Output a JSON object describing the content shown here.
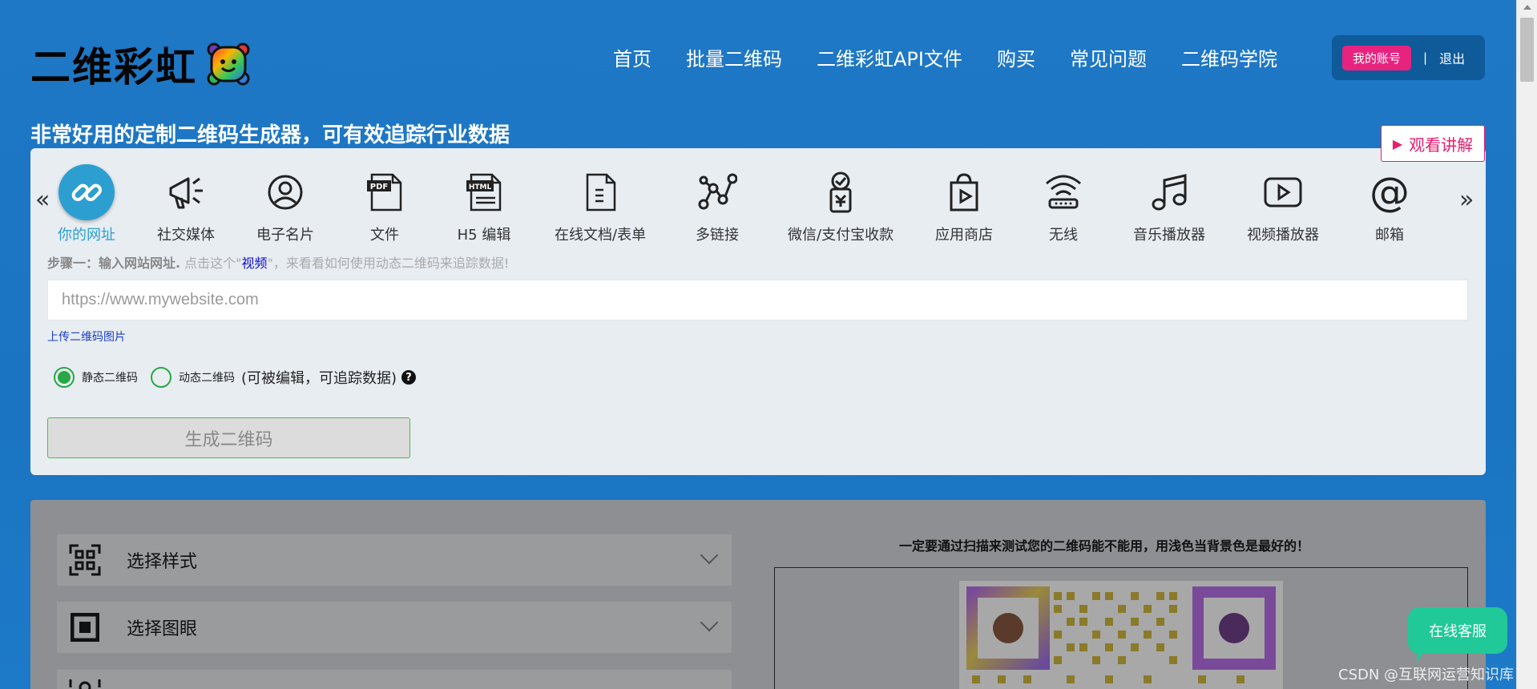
{
  "header": {
    "logo_text": "二维彩虹",
    "nav": [
      "首页",
      "批量二维码",
      "二维彩虹API文件",
      "购买",
      "常见问题",
      "二维码学院"
    ],
    "account_label": "我的账号",
    "separator": "|",
    "logout_label": "退出"
  },
  "tagline": "非常好用的定制二维码生成器，可有效追踪行业数据",
  "watch_button": "观看讲解",
  "carousel": {
    "prev": "«",
    "next": "»",
    "types": [
      {
        "label": "你的网址",
        "icon": "link-icon"
      },
      {
        "label": "社交媒体",
        "icon": "megaphone-icon"
      },
      {
        "label": "电子名片",
        "icon": "user-icon"
      },
      {
        "label": "文件",
        "icon": "pdf-icon"
      },
      {
        "label": "H5 编辑",
        "icon": "html-icon"
      },
      {
        "label": "在线文档/表单",
        "icon": "document-icon"
      },
      {
        "label": "多链接",
        "icon": "network-icon"
      },
      {
        "label": "微信/支付宝收款",
        "icon": "payment-icon"
      },
      {
        "label": "应用商店",
        "icon": "app-store-icon"
      },
      {
        "label": "无线",
        "icon": "wifi-icon"
      },
      {
        "label": "音乐播放器",
        "icon": "music-icon"
      },
      {
        "label": "视频播放器",
        "icon": "video-icon"
      },
      {
        "label": "邮箱",
        "icon": "email-icon"
      }
    ]
  },
  "step": {
    "prefix": "步骤一：输入网站网址.",
    "text1": " 点击这个\"",
    "link": "视频",
    "text2": "\"，来看看如何使用动态二维码来追踪数据!"
  },
  "url_input": {
    "placeholder": "https://www.mywebsite.com",
    "value": ""
  },
  "upload_link": "上传二维码图片",
  "radios": {
    "static_label": "静态二维码",
    "dynamic_label": "动态二维码",
    "dynamic_note": "(可被编辑，可追踪数据)",
    "help": "?"
  },
  "generate_button": "生成二维码",
  "options": [
    {
      "label": "选择样式",
      "icon": "qr-style-icon"
    },
    {
      "label": "选择图眼",
      "icon": "qr-eye-icon"
    }
  ],
  "test_note": "一定要通过扫描来测试您的二维码能不能用，用浅色当背景色是最好的！",
  "chat_button": "在线客服",
  "watermark": "CSDN @互联网运营知识库",
  "colors": {
    "background": "#1f78c6",
    "accent_pink": "#e8237f",
    "active_blue": "#2c9fd0",
    "green": "#28a745",
    "chat_green": "#20c997"
  }
}
